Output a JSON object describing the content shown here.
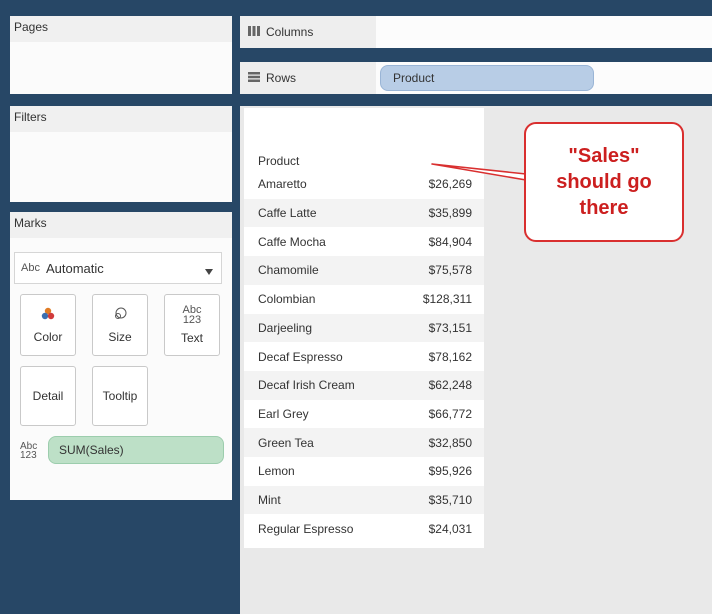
{
  "panels": {
    "pages": {
      "title": "Pages"
    },
    "filters": {
      "title": "Filters"
    },
    "marks": {
      "title": "Marks"
    }
  },
  "marks": {
    "type_label": "Automatic",
    "type_prefix": "Abc",
    "buttons": [
      {
        "label": "Color"
      },
      {
        "label": "Size"
      },
      {
        "label": "Text"
      },
      {
        "label": "Detail"
      },
      {
        "label": "Tooltip"
      }
    ],
    "field_pill": "SUM(Sales)"
  },
  "shelves": {
    "columns": {
      "label": "Columns"
    },
    "rows": {
      "label": "Rows",
      "pill": "Product"
    }
  },
  "table": {
    "header": "Product",
    "rows": [
      {
        "name": "Amaretto",
        "value": "$26,269"
      },
      {
        "name": "Caffe Latte",
        "value": "$35,899"
      },
      {
        "name": "Caffe Mocha",
        "value": "$84,904"
      },
      {
        "name": "Chamomile",
        "value": "$75,578"
      },
      {
        "name": "Colombian",
        "value": "$128,311"
      },
      {
        "name": "Darjeeling",
        "value": "$73,151"
      },
      {
        "name": "Decaf Espresso",
        "value": "$78,162"
      },
      {
        "name": "Decaf Irish Cream",
        "value": "$62,248"
      },
      {
        "name": "Earl Grey",
        "value": "$66,772"
      },
      {
        "name": "Green Tea",
        "value": "$32,850"
      },
      {
        "name": "Lemon",
        "value": "$95,926"
      },
      {
        "name": "Mint",
        "value": "$35,710"
      },
      {
        "name": "Regular Espresso",
        "value": "$24,031"
      }
    ]
  },
  "callout": {
    "line1": "\"Sales\"",
    "line2": "should go",
    "line3": "there",
    "color": "#d92f2f"
  }
}
